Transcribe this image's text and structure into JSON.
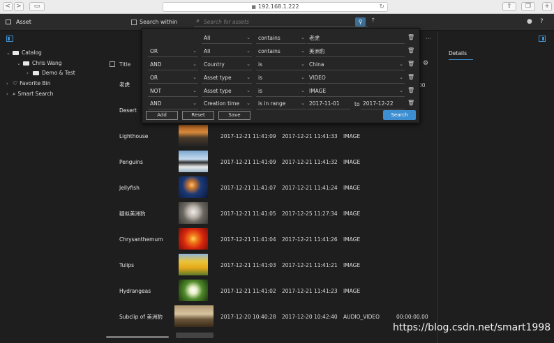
{
  "browser": {
    "url": "192.168.1.222",
    "nav_back": "<",
    "nav_forward": ">"
  },
  "header": {
    "app_title": "Asset",
    "search_within_label": "Search within",
    "search_placeholder": "Search for assets"
  },
  "sidebar": {
    "catalog": "Catalog",
    "user_folder": "Chris Wang",
    "subfolder": "Demo & Test",
    "favorite_bin": "Favorite Bin",
    "smart_search": "Smart Search"
  },
  "table": {
    "title_header": "Title",
    "rows": [
      {
        "name": "Lighthouse",
        "created": "2017-12-21 11:41:09",
        "modified": "2017-12-21 11:41:33",
        "type": "IMAGE",
        "duration": ""
      },
      {
        "name": "Penguins",
        "created": "2017-12-21 11:41:09",
        "modified": "2017-12-21 11:41:32",
        "type": "IMAGE",
        "duration": ""
      },
      {
        "name": "Jellyfish",
        "created": "2017-12-21 11:41:07",
        "modified": "2017-12-21 11:41:24",
        "type": "IMAGE",
        "duration": ""
      },
      {
        "name": "疑似美洲豹",
        "created": "2017-12-21 11:41:05",
        "modified": "2017-12-25 11:27:34",
        "type": "IMAGE",
        "duration": ""
      },
      {
        "name": "Chrysanthemum",
        "created": "2017-12-21 11:41:04",
        "modified": "2017-12-21 11:41:26",
        "type": "IMAGE",
        "duration": ""
      },
      {
        "name": "Tulips",
        "created": "2017-12-21 11:41:03",
        "modified": "2017-12-21 11:41:21",
        "type": "IMAGE",
        "duration": ""
      },
      {
        "name": "Hydrangeas",
        "created": "2017-12-21 11:41:02",
        "modified": "2017-12-21 11:41:23",
        "type": "IMAGE",
        "duration": ""
      },
      {
        "name": "Subclip of 美洲豹",
        "created": "2017-12-20 10:40:28",
        "modified": "2017-12-20 10:42:40",
        "type": "AUDIO_VIDEO",
        "duration": "00:00:00.00"
      }
    ],
    "partial_rows": [
      {
        "name": "老虎"
      },
      {
        "name": "Desert"
      }
    ],
    "cut_value": "00"
  },
  "details": {
    "tab_label": "Details",
    "more": "···"
  },
  "advanced_search": {
    "rows": [
      {
        "logic": "",
        "field": "All",
        "operator": "contains",
        "value": "老虎"
      },
      {
        "logic": "OR",
        "field": "All",
        "operator": "contains",
        "value": "美洲豹"
      },
      {
        "logic": "AND",
        "field": "Country",
        "operator": "is",
        "value": "China"
      },
      {
        "logic": "OR",
        "field": "Asset type",
        "operator": "is",
        "value": "VIDEO"
      },
      {
        "logic": "NOT",
        "field": "Asset type",
        "operator": "is",
        "value": "IMAGE"
      },
      {
        "logic": "AND",
        "field": "Creation time",
        "operator": "is in range",
        "value": "2017-11-01",
        "value2": "2017-12-22"
      }
    ],
    "to_label": "to",
    "add_label": "Add",
    "reset_label": "Reset",
    "save_label": "Save",
    "search_label": "Search"
  },
  "watermark": "https://blog.csdn.net/smart1998",
  "colors": {
    "accent": "#3d8fd1",
    "background": "#1e1e1e",
    "panel": "#262626"
  }
}
